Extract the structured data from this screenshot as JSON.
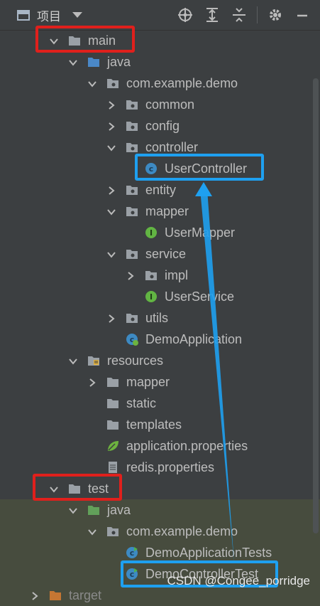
{
  "header": {
    "title": "项目",
    "actions": [
      "crosshair-icon",
      "expand-all-icon",
      "collapse-all-icon",
      "gear-icon",
      "hide-icon"
    ]
  },
  "tree": [
    {
      "name": "main",
      "icon": "folder-grey",
      "expanded": true,
      "depth": 0
    },
    {
      "name": "java",
      "icon": "folder-blue",
      "expanded": true,
      "depth": 1
    },
    {
      "name": "com.example.demo",
      "icon": "package",
      "expanded": true,
      "depth": 2
    },
    {
      "name": "common",
      "icon": "package",
      "expanded": false,
      "depth": 3
    },
    {
      "name": "config",
      "icon": "package",
      "expanded": false,
      "depth": 3
    },
    {
      "name": "controller",
      "icon": "package",
      "expanded": true,
      "depth": 3
    },
    {
      "name": "UserController",
      "icon": "class",
      "depth": 4
    },
    {
      "name": "entity",
      "icon": "package",
      "expanded": false,
      "depth": 3
    },
    {
      "name": "mapper",
      "icon": "package",
      "expanded": true,
      "depth": 3
    },
    {
      "name": "UserMapper",
      "icon": "interface",
      "depth": 4
    },
    {
      "name": "service",
      "icon": "package",
      "expanded": true,
      "depth": 3
    },
    {
      "name": "impl",
      "icon": "package",
      "expanded": false,
      "depth": 4
    },
    {
      "name": "UserService",
      "icon": "interface",
      "depth": 4
    },
    {
      "name": "utils",
      "icon": "package",
      "expanded": false,
      "depth": 3
    },
    {
      "name": "DemoApplication",
      "icon": "spring-class",
      "depth": 3
    },
    {
      "name": "resources",
      "icon": "folder-resources",
      "expanded": true,
      "depth": 1
    },
    {
      "name": "mapper",
      "icon": "folder-grey",
      "expanded": false,
      "depth": 2
    },
    {
      "name": "static",
      "icon": "folder-grey",
      "depth": 2
    },
    {
      "name": "templates",
      "icon": "folder-grey",
      "depth": 2
    },
    {
      "name": "application.properties",
      "icon": "spring-leaf",
      "depth": 2
    },
    {
      "name": "redis.properties",
      "icon": "properties-file",
      "depth": 2
    },
    {
      "name": "test",
      "icon": "folder-grey",
      "expanded": true,
      "depth": 0
    },
    {
      "name": "java",
      "icon": "folder-green",
      "expanded": true,
      "depth": 1
    },
    {
      "name": "com.example.demo",
      "icon": "package",
      "expanded": true,
      "depth": 2
    },
    {
      "name": "DemoApplicationTests",
      "icon": "test-class",
      "depth": 3
    },
    {
      "name": "DemoControllerTest",
      "icon": "test-class",
      "depth": 3
    },
    {
      "name": "target",
      "icon": "folder-orange",
      "expanded": false,
      "depth": -1,
      "dim": true
    }
  ],
  "watermark": "CSDN @Congee_porridge",
  "colors": {
    "highlight_red": "#e0201c",
    "highlight_blue": "#1ea0f0",
    "panel_bg": "#3c3f41",
    "test_bg": "#474c3e"
  }
}
